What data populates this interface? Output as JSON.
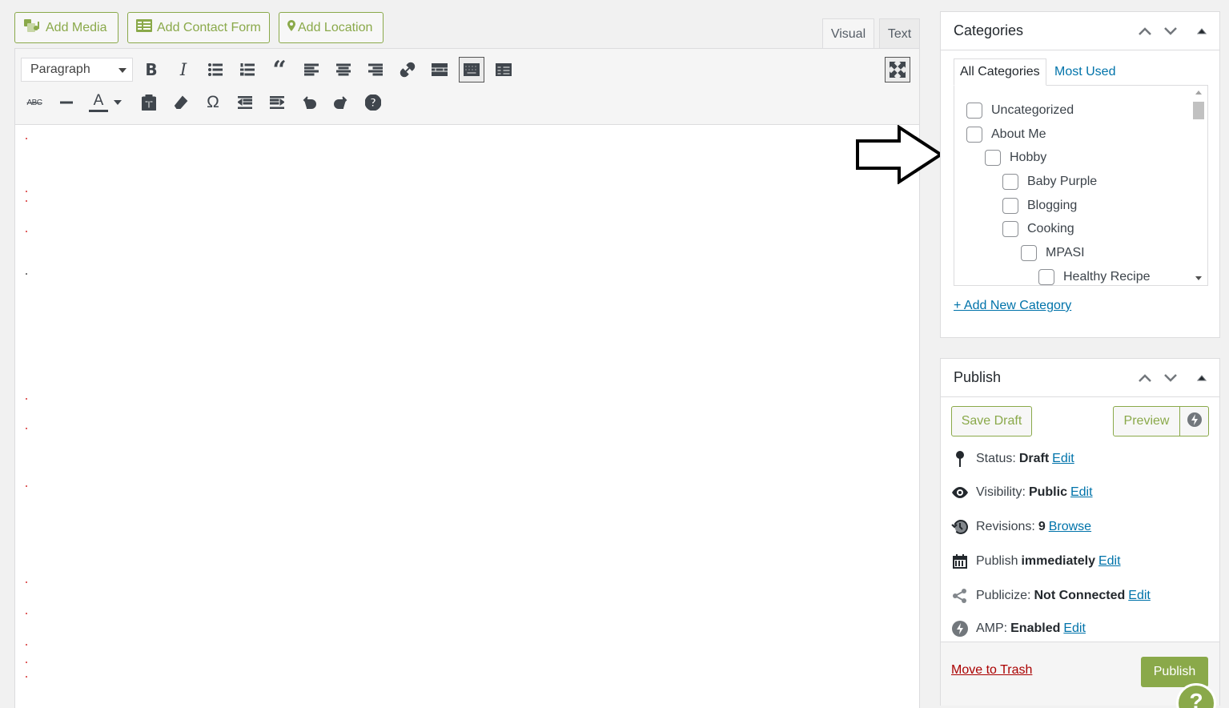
{
  "media_buttons": {
    "add_media": "Add Media",
    "add_contact_form": "Add Contact Form",
    "add_location": "Add Location"
  },
  "editor_tabs": {
    "visual": "Visual",
    "text": "Text"
  },
  "toolbar": {
    "format_select": "Paragraph",
    "strikethrough_label": "ABC",
    "text_color_label": "A",
    "special_char_label": "Ω"
  },
  "categories": {
    "title": "Categories",
    "tabs": {
      "all": "All Categories",
      "most_used": "Most Used"
    },
    "items": [
      {
        "label": "Uncategorized",
        "level": 0
      },
      {
        "label": "About Me",
        "level": 0
      },
      {
        "label": "Hobby",
        "level": 1
      },
      {
        "label": "Baby Purple",
        "level": 2
      },
      {
        "label": "Blogging",
        "level": 2
      },
      {
        "label": "Cooking",
        "level": 2
      },
      {
        "label": "MPASI",
        "level": 3
      },
      {
        "label": "Healthy Recipe",
        "level": 4
      }
    ],
    "add_new": "+ Add New Category"
  },
  "publish": {
    "title": "Publish",
    "save_draft": "Save Draft",
    "preview": "Preview",
    "status": {
      "label": "Status:",
      "value": "Draft",
      "action": "Edit"
    },
    "visibility": {
      "label": "Visibility:",
      "value": "Public",
      "action": "Edit"
    },
    "revisions": {
      "label": "Revisions:",
      "value": "9",
      "action": "Browse"
    },
    "schedule": {
      "label": "Publish",
      "value": "immediately",
      "action": "Edit"
    },
    "publicize": {
      "label": "Publicize:",
      "value": "Not Connected",
      "action": "Edit"
    },
    "amp": {
      "label": "AMP:",
      "value": "Enabled",
      "action": "Edit"
    },
    "trash": "Move to Trash",
    "publish_button": "Publish"
  },
  "help_label": "?",
  "colors": {
    "accent": "#8aa94a",
    "link": "#0073aa",
    "danger": "#a00"
  }
}
